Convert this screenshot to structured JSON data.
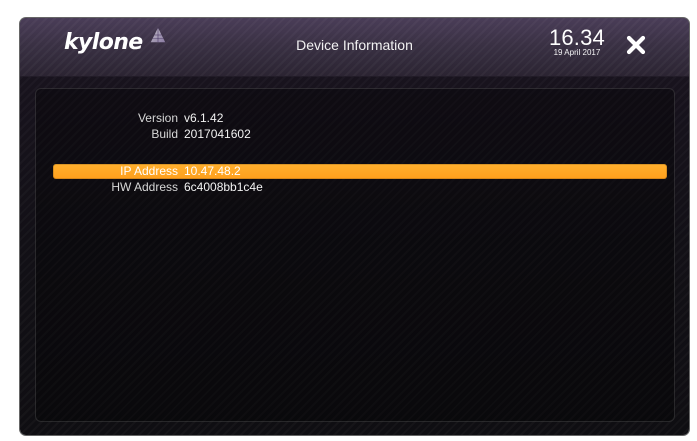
{
  "header": {
    "brand": "kylone",
    "title": "Device Information",
    "time": "16.34",
    "date": "19 April 2017",
    "close_icon": "close-icon",
    "logo_icon": "triangle-mark-icon"
  },
  "device_info": {
    "rows": [
      {
        "label": "Version",
        "value": "v6.1.42"
      },
      {
        "label": "Build",
        "value": "2017041602"
      },
      {
        "label": "IP Address",
        "value": "10.47.48.2",
        "selected": true
      },
      {
        "label": "HW Address",
        "value": "6c4008bb1c4e"
      }
    ]
  },
  "colors": {
    "topbar": "#3a3144",
    "background": "#121016",
    "selected_row": "#ff9f1c",
    "text": "#f2f2f2"
  }
}
